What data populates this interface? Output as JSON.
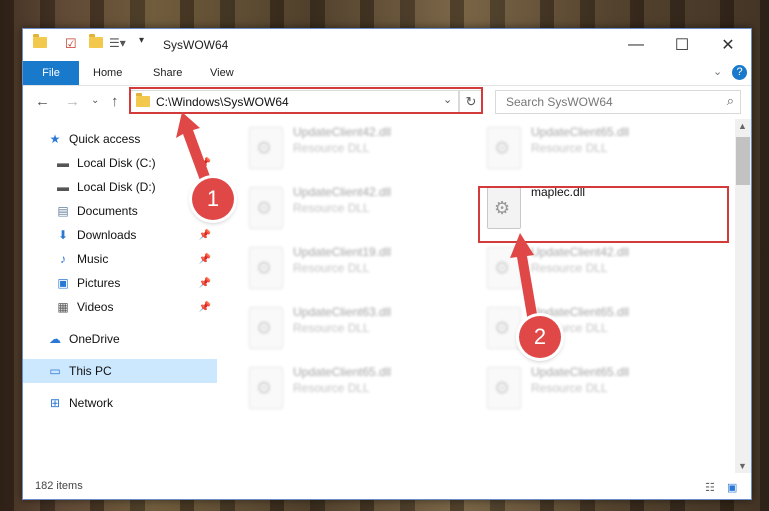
{
  "window": {
    "title": "SysWOW64"
  },
  "ribbon": {
    "file": "File",
    "tabs": [
      "Home",
      "Share",
      "View"
    ]
  },
  "address": {
    "path": "C:\\Windows\\SysWOW64"
  },
  "search": {
    "placeholder": "Search SysWOW64"
  },
  "sidebar": {
    "items": [
      {
        "label": "Quick access",
        "icon": "star-icon"
      },
      {
        "label": "Local Disk (C:)",
        "icon": "drive-icon",
        "pinned": true
      },
      {
        "label": "Local Disk (D:)",
        "icon": "drive-icon"
      },
      {
        "label": "Documents",
        "icon": "documents-icon"
      },
      {
        "label": "Downloads",
        "icon": "download-icon",
        "pinned": true
      },
      {
        "label": "Music",
        "icon": "music-icon",
        "pinned": true
      },
      {
        "label": "Pictures",
        "icon": "pictures-icon",
        "pinned": true
      },
      {
        "label": "Videos",
        "icon": "videos-icon",
        "pinned": true
      },
      {
        "label": "OneDrive",
        "icon": "cloud-icon"
      },
      {
        "label": "This PC",
        "icon": "computer-icon",
        "selected": true
      },
      {
        "label": "Network",
        "icon": "network-icon"
      }
    ]
  },
  "files": [
    {
      "name": "UpdateClient42.dll",
      "type": "Resource DLL"
    },
    {
      "name": "UpdateClient65.dll",
      "type": "Resource DLL"
    },
    {
      "name": "UpdateClient42.dll",
      "type": "Resource DLL"
    },
    {
      "name": "maplec.dll",
      "type": ""
    },
    {
      "name": "UpdateClient19.dll",
      "type": "Resource DLL"
    },
    {
      "name": "UpdateClient42.dll",
      "type": "Resource DLL"
    },
    {
      "name": "UpdateClient63.dll",
      "type": "Resource DLL"
    },
    {
      "name": "UpdateClient65.dll",
      "type": "Resource DLL"
    },
    {
      "name": "UpdateClient65.dll",
      "type": "Resource DLL"
    },
    {
      "name": "UpdateClient65.dll",
      "type": "Resource DLL"
    }
  ],
  "status": {
    "items": "182 items"
  },
  "steps": [
    "1",
    "2"
  ],
  "colors": {
    "accent": "#1979ca",
    "highlight": "#d43a3a",
    "badge": "#e04848"
  }
}
